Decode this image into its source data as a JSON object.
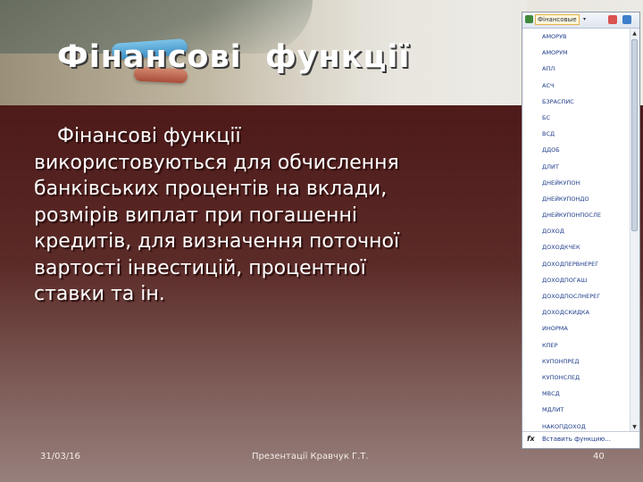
{
  "slide": {
    "title": "Фінансові  функції",
    "body_lines": [
      "Фінансові функції",
      "використовуються для обчислення",
      "банківських процентів на вклади,",
      "розмірів виплат при погашенні",
      "кредитів, для визначення поточної",
      "вартості інвестицій, процентної",
      "ставки та ін."
    ]
  },
  "function_menu": {
    "category_label": "Фінансовые",
    "items": [
      "АМОРУВ",
      "АМОРУМ",
      "АПЛ",
      "АСЧ",
      "БЗРАСПИС",
      "БС",
      "ВСД",
      "ДДОБ",
      "ДЛИТ",
      "ДНЕЙКУПОН",
      "ДНЕЙКУПОНДО",
      "ДНЕЙКУПОНПОСЛЕ",
      "ДОХОД",
      "ДОХОДКЧЕК",
      "ДОХОДПЕРВНЕРЕГ",
      "ДОХОДПОГАШ",
      "ДОХОДПОСЛНЕРЕГ",
      "ДОХОДСКИДКА",
      "ИНОРМА",
      "КПЕР",
      "КУПОНПРЕД",
      "КУПОНСЛЕД",
      "МВСД",
      "МДЛИТ",
      "НАКОПДОХОД"
    ],
    "footer_icon": "fx",
    "footer_label": "Вставить функцию..."
  },
  "footer": {
    "date": "31/03/16",
    "center_text": "Презентації Кравчук Г.Т.",
    "page_number": "40"
  }
}
